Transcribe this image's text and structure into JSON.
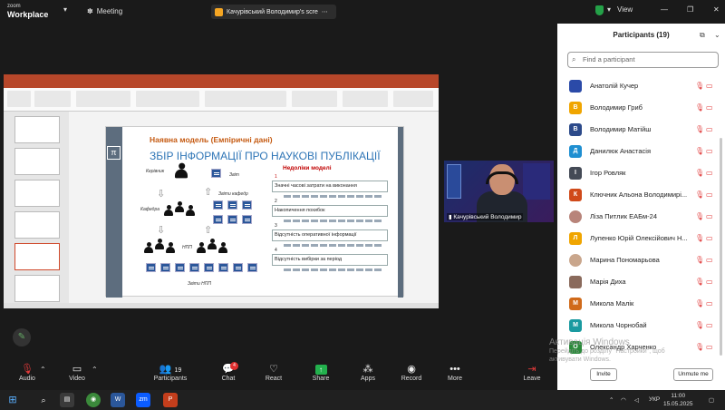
{
  "app": {
    "brand_line1": "zoom",
    "brand_line2": "Workplace",
    "meeting_label": "Meeting",
    "share_title": "Качурівський Володимир's scre",
    "view_label": "View"
  },
  "window_controls": {
    "minimize": "—",
    "restore": "❐",
    "close": "✕"
  },
  "slide": {
    "subtitle": "Наявна модель (Емпіричні дані)",
    "title": "ЗБІР ІНФОРМАЦІЇ ПРО НАУКОВІ ПУБЛІКАЦІЇ",
    "caption_kerivnyk": "Керівник",
    "caption_kafedra": "Кафедра",
    "caption_npp": "НПП",
    "caption_zvit": "Звіт",
    "caption_zvity_kafedry": "Звіти кафедр",
    "caption_zvity_npp": "Звіти НПП",
    "nedoliky_title": "Недоліки моделі",
    "nedoliky": [
      {
        "num": "1",
        "text": "Значні часові затрати на виконання"
      },
      {
        "num": "2",
        "text": "Накопичення похибок"
      },
      {
        "num": "3",
        "text": "Відсутність оперативної інформації"
      },
      {
        "num": "4",
        "text": "Відсутність вибірки за період"
      }
    ]
  },
  "video": {
    "participant_name": "Качурівський Володимир"
  },
  "toolbar": {
    "audio": "Audio",
    "video": "Video",
    "participants": "Participants",
    "participants_count": "19",
    "chat": "Chat",
    "chat_badge": "4",
    "react": "React",
    "share": "Share",
    "apps": "Apps",
    "record": "Record",
    "more": "More",
    "leave": "Leave"
  },
  "participants_panel": {
    "title": "Participants (19)",
    "search_placeholder": "Find a participant",
    "invite": "Invite",
    "unmute_me": "Unmute me",
    "list": [
      {
        "name": "Анатолій Кучер",
        "initial": "",
        "color": "#2b4aa8"
      },
      {
        "name": "Володимир  Гриб",
        "initial": "В",
        "color": "#f0a500"
      },
      {
        "name": "Володимир Матійш",
        "initial": "В",
        "color": "#2c4a8a"
      },
      {
        "name": "Данилюк Анастасія",
        "initial": "Д",
        "color": "#1f8fd1"
      },
      {
        "name": "Ігор Ровляк",
        "initial": "І",
        "color": "#444a56"
      },
      {
        "name": "Ключник Альона Володимирі...",
        "initial": "К",
        "color": "#d04a1a"
      },
      {
        "name": "Ліза Питлик ЕАБм-24",
        "initial": "",
        "color": "#b8847a"
      },
      {
        "name": "Лупенко Юрій Олексійович  Н...",
        "initial": "Л",
        "color": "#f0a500"
      },
      {
        "name": "Марина Пономарьова",
        "initial": "",
        "color": "#c9a68c"
      },
      {
        "name": "Марія Диха",
        "initial": "",
        "color": "#8a6a5c"
      },
      {
        "name": "Микола Малік",
        "initial": "М",
        "color": "#d06a1a"
      },
      {
        "name": "Микола Чорнобай",
        "initial": "М",
        "color": "#1a9aa0"
      },
      {
        "name": "Олександр Харченко",
        "initial": "О",
        "color": "#2a8a3a"
      }
    ]
  },
  "windows_watermark": {
    "line1": "Активація Windows",
    "line2": "Перейдіть до розділу \"Настройки\", щоб",
    "line3": "активувати Windows."
  },
  "taskbar": {
    "lang": "УКР",
    "time": "11:00",
    "date": "15.05.2025"
  }
}
